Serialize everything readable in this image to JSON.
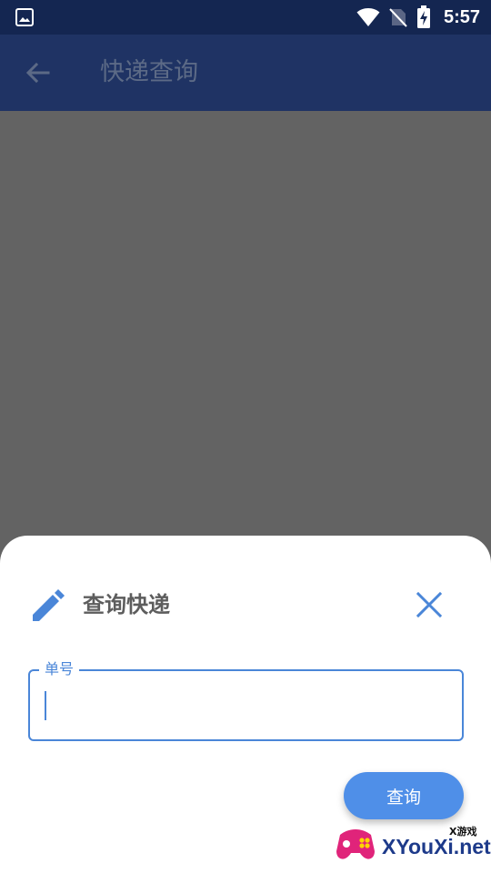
{
  "status_bar": {
    "time": "5:57",
    "icons": [
      "gallery-icon",
      "wifi-icon",
      "no-sim-icon",
      "battery-charging-icon"
    ]
  },
  "app_bar": {
    "title": "快递查询",
    "back_icon": "arrow-left-icon"
  },
  "dialog": {
    "title": "查询快递",
    "title_icon": "pencil-icon",
    "close_icon": "close-icon",
    "field_label": "单号",
    "field_value": "",
    "submit_label": "查询"
  },
  "watermark": {
    "small_text": "X游戏",
    "text": "XYouXi.net"
  },
  "colors": {
    "status_bar": "#142651",
    "app_bar": "#1f3364",
    "scrim": "#636363",
    "accent": "#4a86d8",
    "button": "#4f8fe8"
  }
}
